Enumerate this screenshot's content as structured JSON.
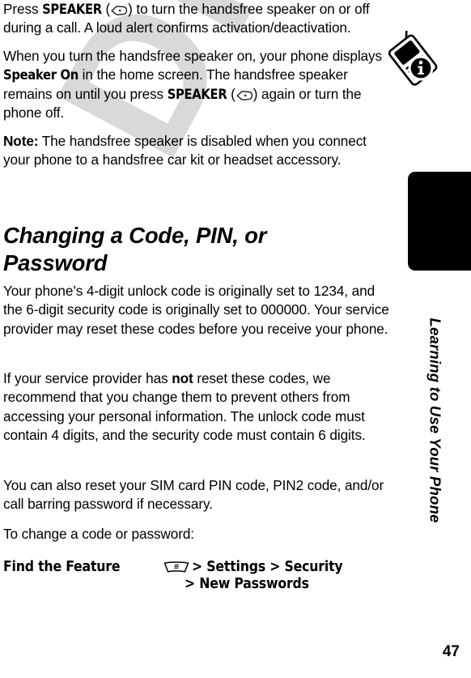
{
  "document": {
    "watermark": "DRAFT",
    "page_number": "47",
    "chapter_title": "Learning to Use Your Phone"
  },
  "paragraphs": {
    "p1_a": "Press ",
    "p1_speaker": "SPEAKER",
    "p1_b": " (",
    "p1_c": ") to turn the handsfree speaker on or off during a call. A loud alert confirms activation/deactivation.",
    "p2_a": "When you turn the handsfree speaker on, your phone displays ",
    "p2_speaker_on": "Speaker On",
    "p2_b": " in the home screen. The handsfree speaker remains on until you press ",
    "p2_speaker": "SPEAKER",
    "p2_c": " (",
    "p2_d": ") again or turn the phone off.",
    "p3_note_label": "Note:",
    "p3_text": " The handsfree speaker is disabled when you connect your phone to a handsfree car kit or headset accessory.",
    "p4_text": "Your phone’s 4-digit unlock code is originally set to 1234, and the 6-digit security code is originally set to 000000. Your service provider may reset these codes before you receive your phone.",
    "p5_a": "If your service provider has ",
    "p5_not": "not",
    "p5_b": " reset these codes, we recommend that you change them to prevent others from accessing your personal information. The unlock code must contain 4 digits, and the security code must contain 6 digits.",
    "p6_text": "You can also reset your SIM card PIN code, PIN2 code, and/or call barring password if necessary.",
    "p7_text": "To change a code or password:"
  },
  "heading": {
    "text": "Changing a Code, PIN, or Password"
  },
  "find_feature": {
    "label": "Find the Feature",
    "menu_icon": "menu-key-icon",
    "path_line1": "> Settings > Security",
    "path_line2": "> New Passwords"
  },
  "icons": {
    "speaker_key": "speaker-soft-key-icon",
    "chapter_tab": "phone-info-icon",
    "info": "info-circle-icon"
  },
  "colors": {
    "text": "#000000",
    "background": "#ffffff",
    "watermark": "#d9d9d9",
    "tab": "#000000"
  }
}
